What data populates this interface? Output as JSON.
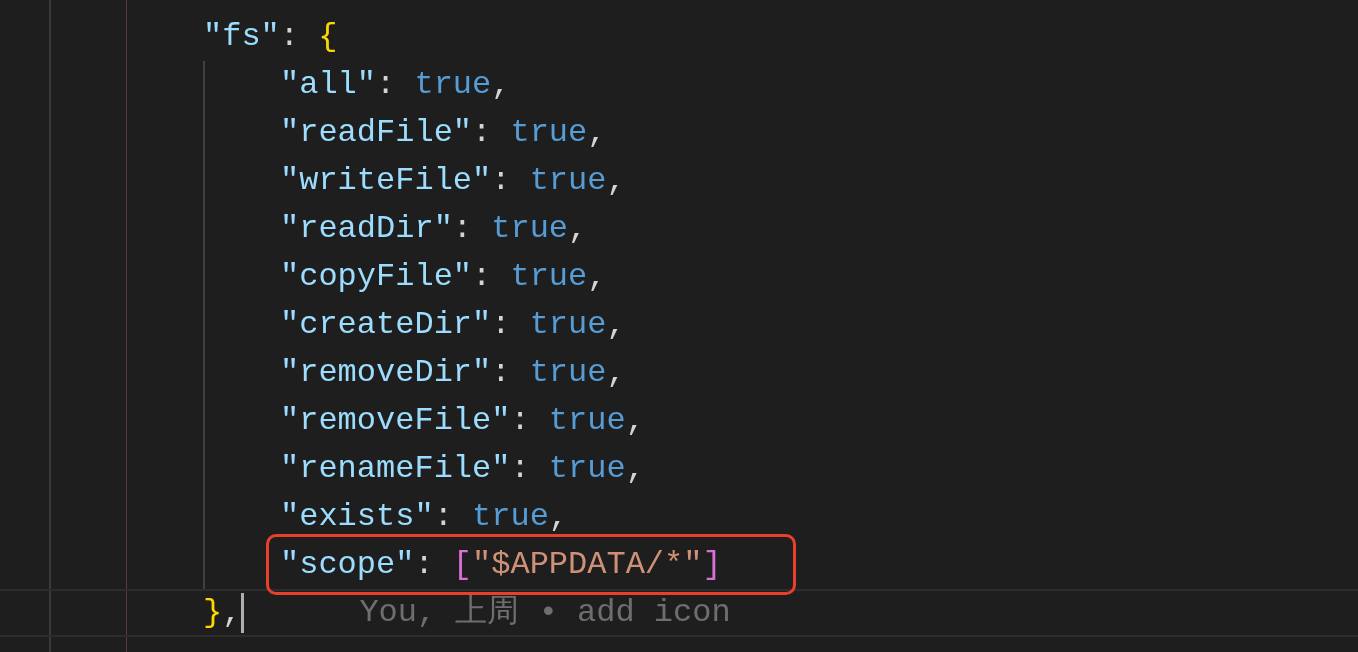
{
  "editor": {
    "lines": [
      {
        "tokens": [
          {
            "kind": "key",
            "text": "\"fs\""
          },
          {
            "kind": "punct",
            "text": ": "
          },
          {
            "kind": "brace",
            "text": "{"
          }
        ],
        "children": [
          {
            "tokens": [
              {
                "kind": "key",
                "text": "\"all\""
              },
              {
                "kind": "punct",
                "text": ": "
              },
              {
                "kind": "bool",
                "text": "true"
              },
              {
                "kind": "punct",
                "text": ","
              }
            ]
          },
          {
            "tokens": [
              {
                "kind": "key",
                "text": "\"readFile\""
              },
              {
                "kind": "punct",
                "text": ": "
              },
              {
                "kind": "bool",
                "text": "true"
              },
              {
                "kind": "punct",
                "text": ","
              }
            ]
          },
          {
            "tokens": [
              {
                "kind": "key",
                "text": "\"writeFile\""
              },
              {
                "kind": "punct",
                "text": ": "
              },
              {
                "kind": "bool",
                "text": "true"
              },
              {
                "kind": "punct",
                "text": ","
              }
            ]
          },
          {
            "tokens": [
              {
                "kind": "key",
                "text": "\"readDir\""
              },
              {
                "kind": "punct",
                "text": ": "
              },
              {
                "kind": "bool",
                "text": "true"
              },
              {
                "kind": "punct",
                "text": ","
              }
            ]
          },
          {
            "tokens": [
              {
                "kind": "key",
                "text": "\"copyFile\""
              },
              {
                "kind": "punct",
                "text": ": "
              },
              {
                "kind": "bool",
                "text": "true"
              },
              {
                "kind": "punct",
                "text": ","
              }
            ]
          },
          {
            "tokens": [
              {
                "kind": "key",
                "text": "\"createDir\""
              },
              {
                "kind": "punct",
                "text": ": "
              },
              {
                "kind": "bool",
                "text": "true"
              },
              {
                "kind": "punct",
                "text": ","
              }
            ]
          },
          {
            "tokens": [
              {
                "kind": "key",
                "text": "\"removeDir\""
              },
              {
                "kind": "punct",
                "text": ": "
              },
              {
                "kind": "bool",
                "text": "true"
              },
              {
                "kind": "punct",
                "text": ","
              }
            ]
          },
          {
            "tokens": [
              {
                "kind": "key",
                "text": "\"removeFile\""
              },
              {
                "kind": "punct",
                "text": ": "
              },
              {
                "kind": "bool",
                "text": "true"
              },
              {
                "kind": "punct",
                "text": ","
              }
            ]
          },
          {
            "tokens": [
              {
                "kind": "key",
                "text": "\"renameFile\""
              },
              {
                "kind": "punct",
                "text": ": "
              },
              {
                "kind": "bool",
                "text": "true"
              },
              {
                "kind": "punct",
                "text": ","
              }
            ]
          },
          {
            "tokens": [
              {
                "kind": "key",
                "text": "\"exists\""
              },
              {
                "kind": "punct",
                "text": ": "
              },
              {
                "kind": "bool",
                "text": "true"
              },
              {
                "kind": "punct",
                "text": ","
              }
            ]
          },
          {
            "tokens": [
              {
                "kind": "key",
                "text": "\"scope\""
              },
              {
                "kind": "punct",
                "text": ": "
              },
              {
                "kind": "bracket",
                "text": "["
              },
              {
                "kind": "string",
                "text": "\"$APPDATA/*\""
              },
              {
                "kind": "bracket",
                "text": "]"
              }
            ]
          }
        ]
      },
      {
        "tokens": [
          {
            "kind": "brace",
            "text": "}"
          },
          {
            "kind": "punct",
            "text": ","
          }
        ],
        "current": true,
        "blame": "You, 上周 • add icon"
      }
    ]
  }
}
